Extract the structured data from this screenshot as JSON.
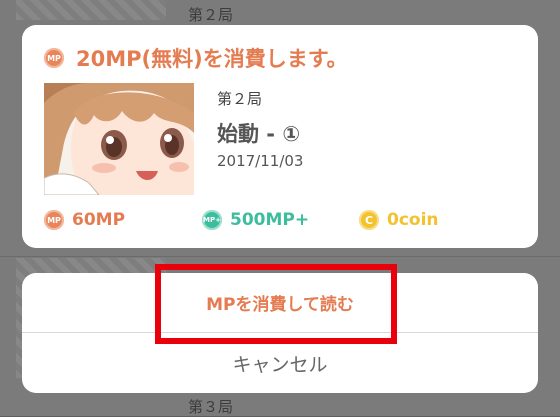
{
  "background": {
    "rows": [
      {
        "title": "第２局"
      },
      {
        "title": "第３局"
      }
    ]
  },
  "dialog": {
    "header": {
      "coin_icon": "mp-coin-icon",
      "text": "20MP(無料)を消費します。"
    },
    "episode": {
      "number": "第２局",
      "title": "始動 - ①",
      "date": "2017/11/03"
    },
    "balances": [
      {
        "icon": "mp-coin-icon",
        "icon_text": "MP",
        "value": "60MP",
        "color": "#e57c51"
      },
      {
        "icon": "mp-plus-coin-icon",
        "icon_text": "MP+",
        "value": "500MP+",
        "color": "#3dbd9e"
      },
      {
        "icon": "c-coin-icon",
        "icon_text": "C",
        "value": "0coin",
        "color": "#f2c22f"
      }
    ]
  },
  "sheet": {
    "consume_label": "MPを消費して読む",
    "cancel_label": "キャンセル"
  },
  "colors": {
    "accent": "#e57c51",
    "mp_plus": "#3dbd9e",
    "coin": "#f2c22f",
    "highlight": "#e8000b"
  }
}
